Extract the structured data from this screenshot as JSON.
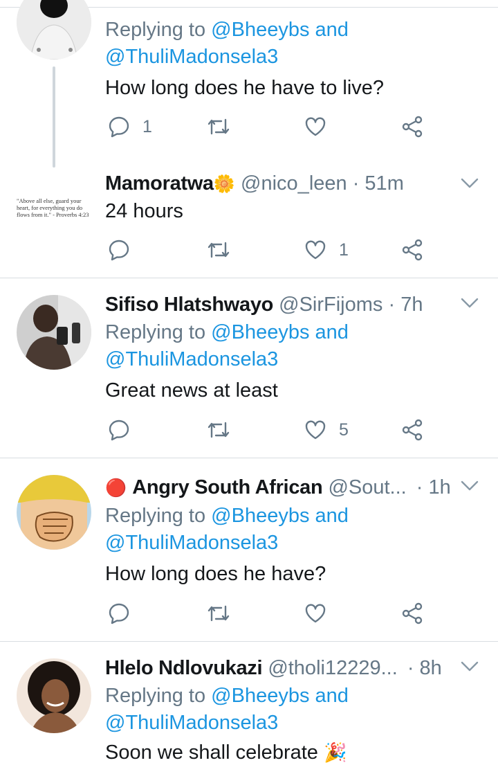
{
  "reply_prefix": "Replying to",
  "tweets": [
    {
      "id": 0,
      "reply_to": [
        "@Bheeybs",
        "and",
        "@ThuliMadonsela3"
      ],
      "text": "How long does he have to live?",
      "counts": {
        "reply": "1",
        "retweet": "",
        "like": ""
      }
    },
    {
      "id": 1,
      "name": "Mamoratwa",
      "emoji": "🌼",
      "handle": "@nico_leen",
      "time": "· 51m",
      "text": "24 hours",
      "avatar_quote": "\"Above all else, guard your heart, for everything you do flows from it.\" - Proverbs 4:23",
      "counts": {
        "reply": "",
        "retweet": "",
        "like": "1"
      }
    },
    {
      "id": 2,
      "name": "Sifiso Hlatshwayo",
      "handle": "@SirFijoms",
      "time": "· 7h",
      "reply_to": [
        "@Bheeybs",
        "and",
        "@ThuliMadonsela3"
      ],
      "text": "Great news at least",
      "counts": {
        "reply": "",
        "retweet": "",
        "like": "5"
      }
    },
    {
      "id": 3,
      "name": "Angry South African",
      "emoji": "🔴",
      "handle": "@Sout...",
      "time": "· 1h",
      "reply_to": [
        "@Bheeybs",
        "and",
        "@ThuliMadonsela3"
      ],
      "text": "How long does he have?",
      "counts": {
        "reply": "",
        "retweet": "",
        "like": ""
      }
    },
    {
      "id": 4,
      "name": "Hlelo Ndlovukazi",
      "handle": "@tholi12229...",
      "time": "· 8h",
      "reply_to": [
        "@Bheeybs",
        "and",
        "@ThuliMadonsela3"
      ],
      "text": "Soon we shall celebrate",
      "text_emoji": "🎉"
    }
  ],
  "colors": {
    "accent": "#1b95e0",
    "muted": "#657786",
    "divider": "#d8dde1"
  },
  "icons": [
    "reply-icon",
    "retweet-icon",
    "like-icon",
    "share-icon",
    "chevron-down-icon"
  ]
}
